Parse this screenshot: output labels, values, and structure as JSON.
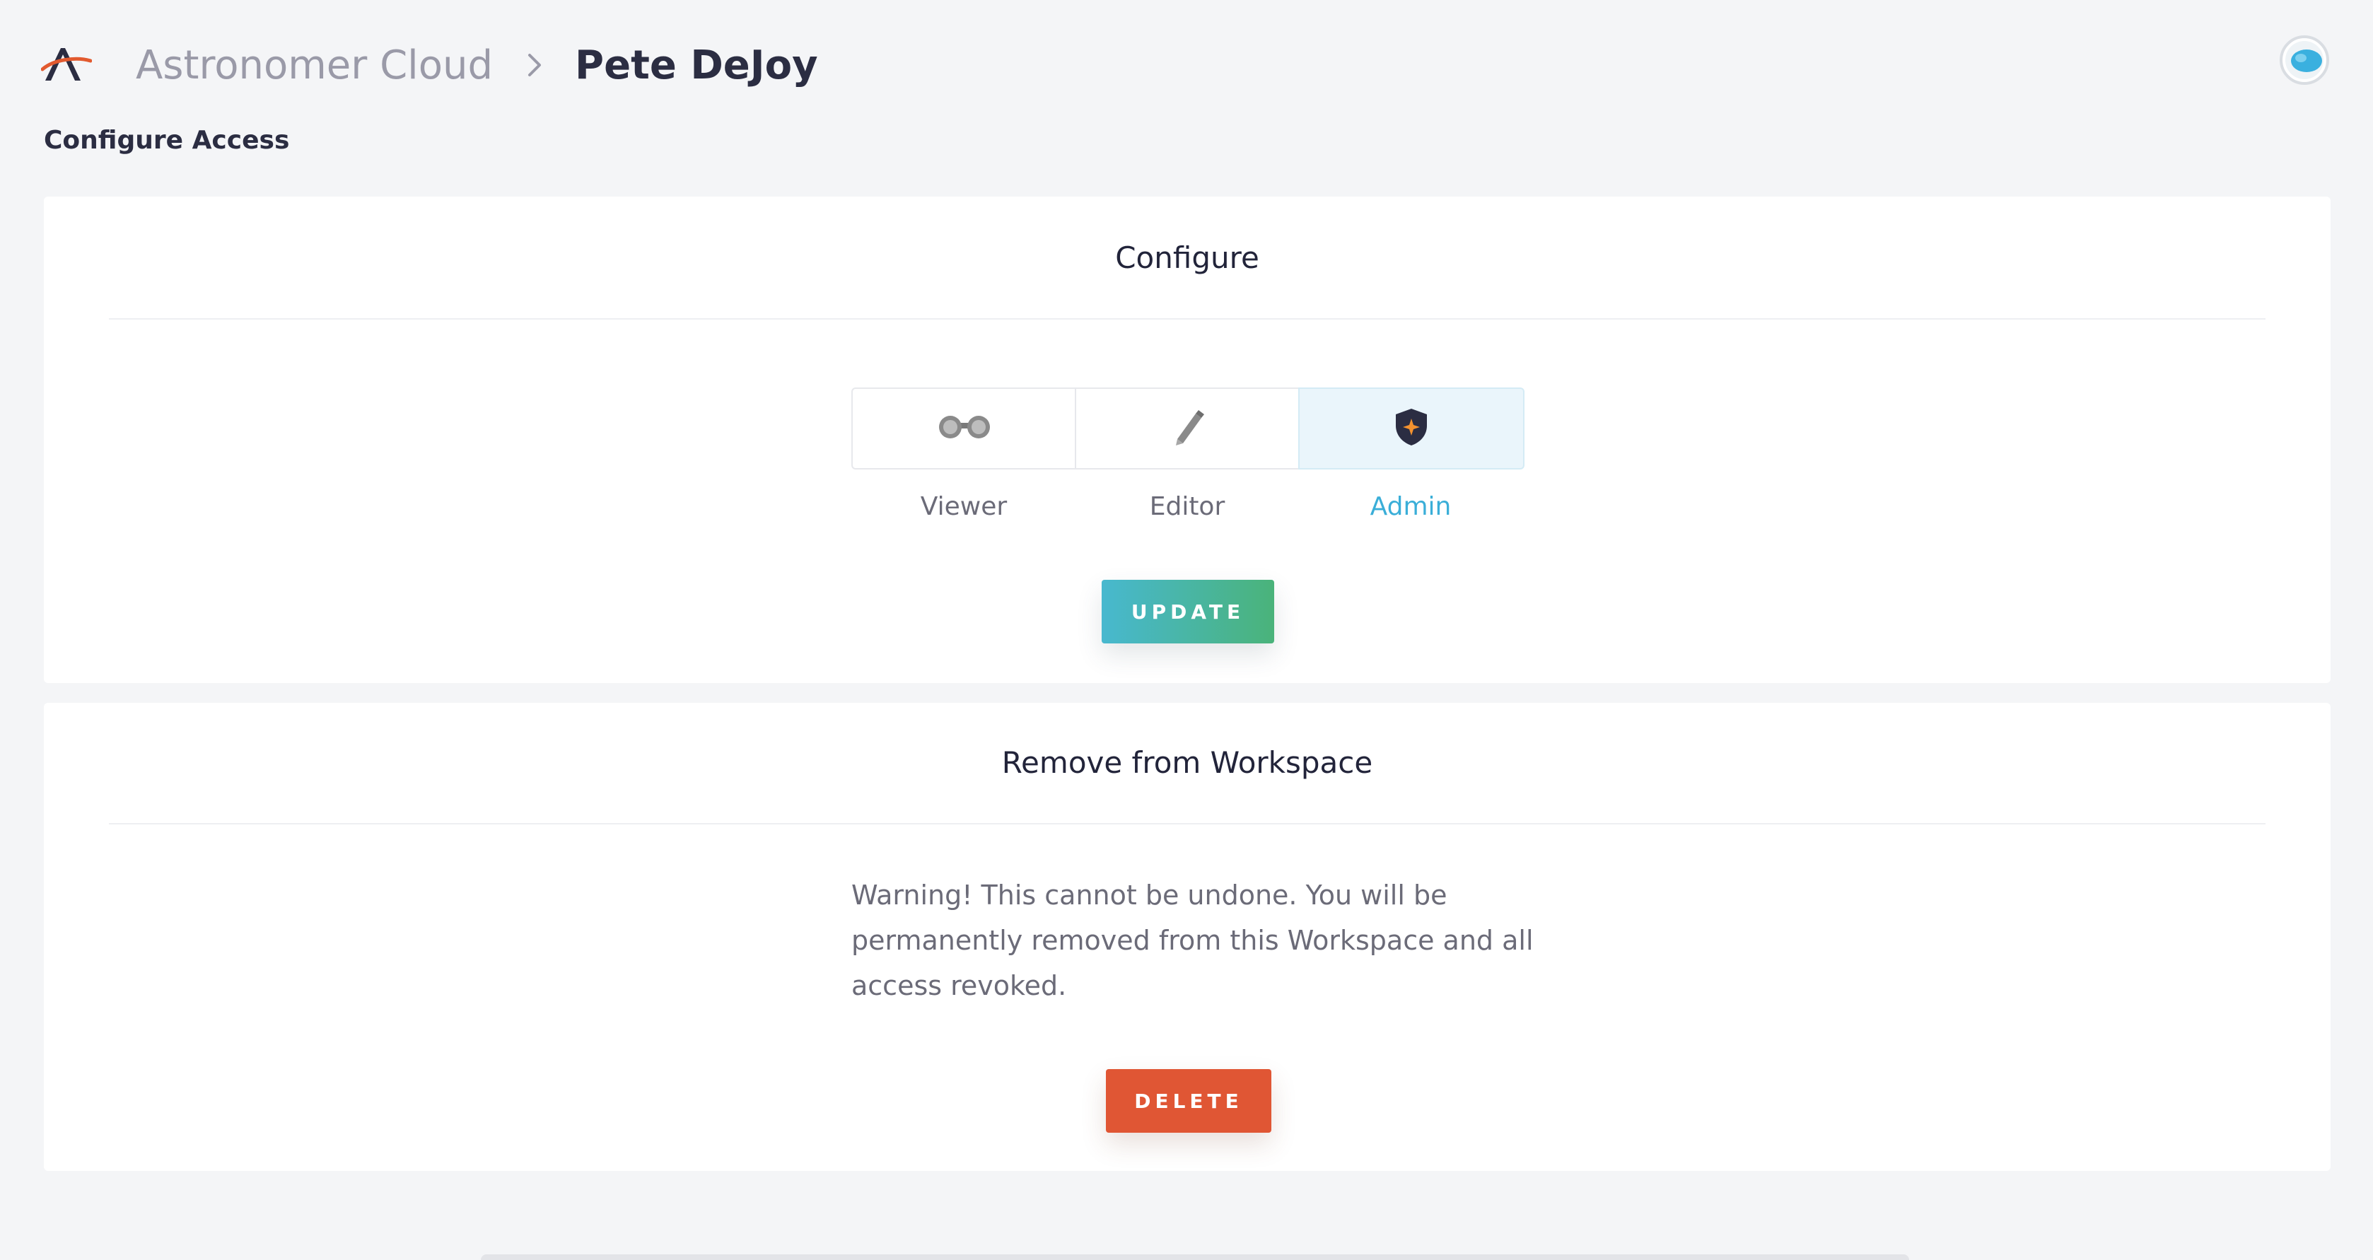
{
  "header": {
    "logo_icon": "astronomer-logo-icon",
    "breadcrumb": {
      "parent": "Astronomer Cloud",
      "separator_icon": "chevron-right-icon",
      "current": "Pete DeJoy"
    },
    "avatar_icon": "user-avatar-icon"
  },
  "page": {
    "title": "Configure Access"
  },
  "configure": {
    "title": "Configure",
    "roles": [
      {
        "label": "Viewer",
        "icon": "binoculars-icon",
        "selected": false
      },
      {
        "label": "Editor",
        "icon": "pencil-icon",
        "selected": false
      },
      {
        "label": "Admin",
        "icon": "shield-icon",
        "selected": true
      }
    ],
    "update_label": "UPDATE"
  },
  "remove": {
    "title": "Remove from Workspace",
    "warning": "Warning! This cannot be undone. You will be permanently removed from this Workspace and all access revoked.",
    "delete_label": "DELETE"
  },
  "colors": {
    "accent": "#3aaed8",
    "update_gradient_start": "#48b8cf",
    "update_gradient_end": "#4ab37a",
    "danger": "#e05634",
    "background": "#f4f5f7"
  }
}
